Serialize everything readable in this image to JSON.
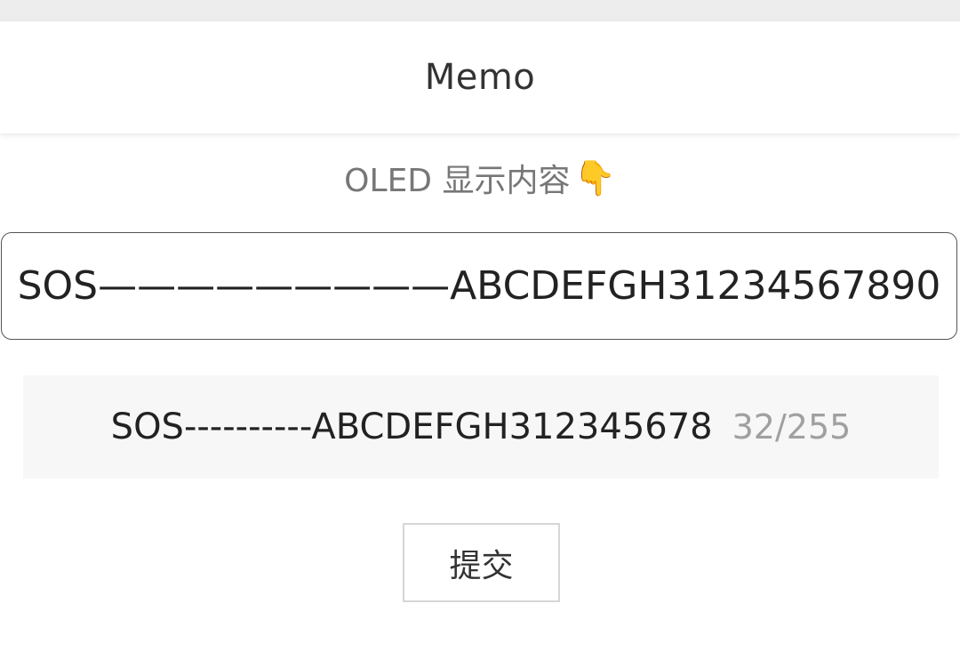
{
  "header": {
    "title": "Memo"
  },
  "section": {
    "label": "OLED 显示内容",
    "icon": "point-down-icon",
    "icon_glyph": "👇"
  },
  "input": {
    "value": "SOS—————————ABCDEFGH31234567890"
  },
  "preview": {
    "text": "SOS----------ABCDEFGH312345678",
    "counter": "32/255"
  },
  "submit": {
    "label": "提交"
  }
}
